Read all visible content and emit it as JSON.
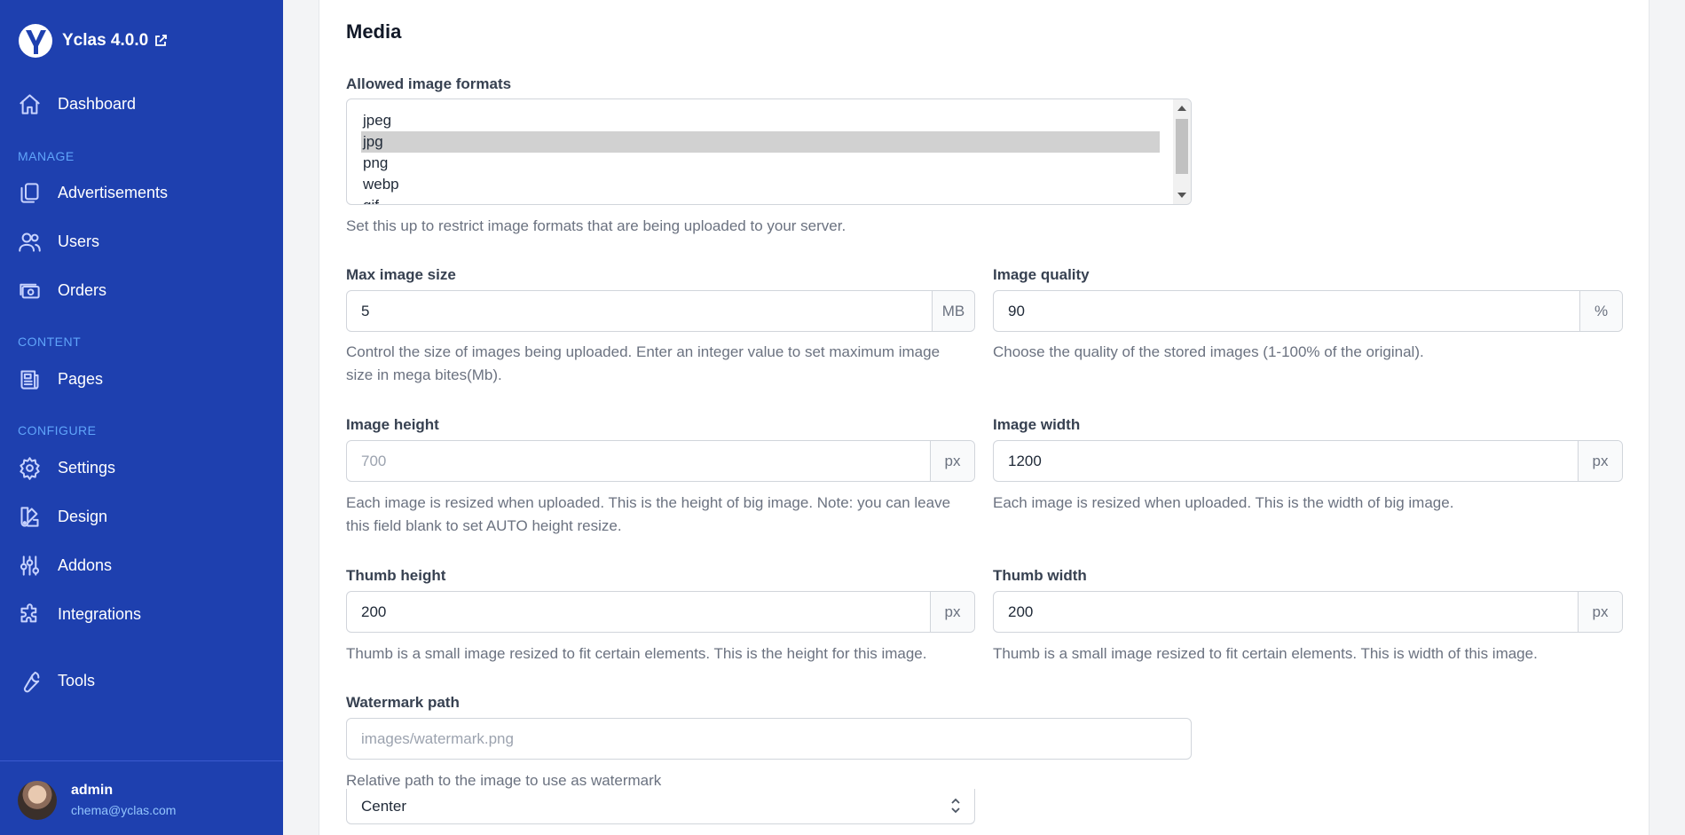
{
  "brand": {
    "name": "Yclas 4.0.0"
  },
  "nav": {
    "dashboard": "Dashboard",
    "manage_label": "MANAGE",
    "advertisements": "Advertisements",
    "users": "Users",
    "orders": "Orders",
    "content_label": "CONTENT",
    "pages": "Pages",
    "configure_label": "CONFIGURE",
    "settings": "Settings",
    "design": "Design",
    "addons": "Addons",
    "integrations": "Integrations",
    "tools": "Tools"
  },
  "user": {
    "name": "admin",
    "email": "chema@yclas.com"
  },
  "media": {
    "title": "Media",
    "formats": {
      "label": "Allowed image formats",
      "options": [
        "jpeg",
        "jpg",
        "png",
        "webp",
        "gif"
      ],
      "selected": "jpg",
      "help": "Set this up to restrict image formats that are being uploaded to your server."
    },
    "max_size": {
      "label": "Max image size",
      "value": "5",
      "unit": "MB",
      "help1": "Control the size of images being uploaded. Enter an integer value to set maximum image",
      "help2": "size in mega bites(Mb)."
    },
    "quality": {
      "label": "Image quality",
      "value": "90",
      "unit": "%",
      "help": "Choose the quality of the stored images (1-100% of the original)."
    },
    "height": {
      "label": "Image height",
      "value": "",
      "placeholder": "700",
      "unit": "px",
      "help1": "Each image is resized when uploaded. This is the height of big image. Note: you can leave",
      "help2": "this field blank to set AUTO height resize."
    },
    "width": {
      "label": "Image width",
      "value": "1200",
      "unit": "px",
      "help": "Each image is resized when uploaded. This is the width of big image."
    },
    "thumb_height": {
      "label": "Thumb height",
      "value": "200",
      "unit": "px",
      "help": "Thumb is a small image resized to fit certain elements. This is the height for this image."
    },
    "thumb_width": {
      "label": "Thumb width",
      "value": "200",
      "unit": "px",
      "help": "Thumb is a small image resized to fit certain elements. This is width of this image."
    },
    "watermark": {
      "label": "Watermark path",
      "value": "",
      "placeholder": "images/watermark.png",
      "help": "Relative path to the image to use as watermark"
    },
    "position": {
      "value": "Center"
    }
  }
}
